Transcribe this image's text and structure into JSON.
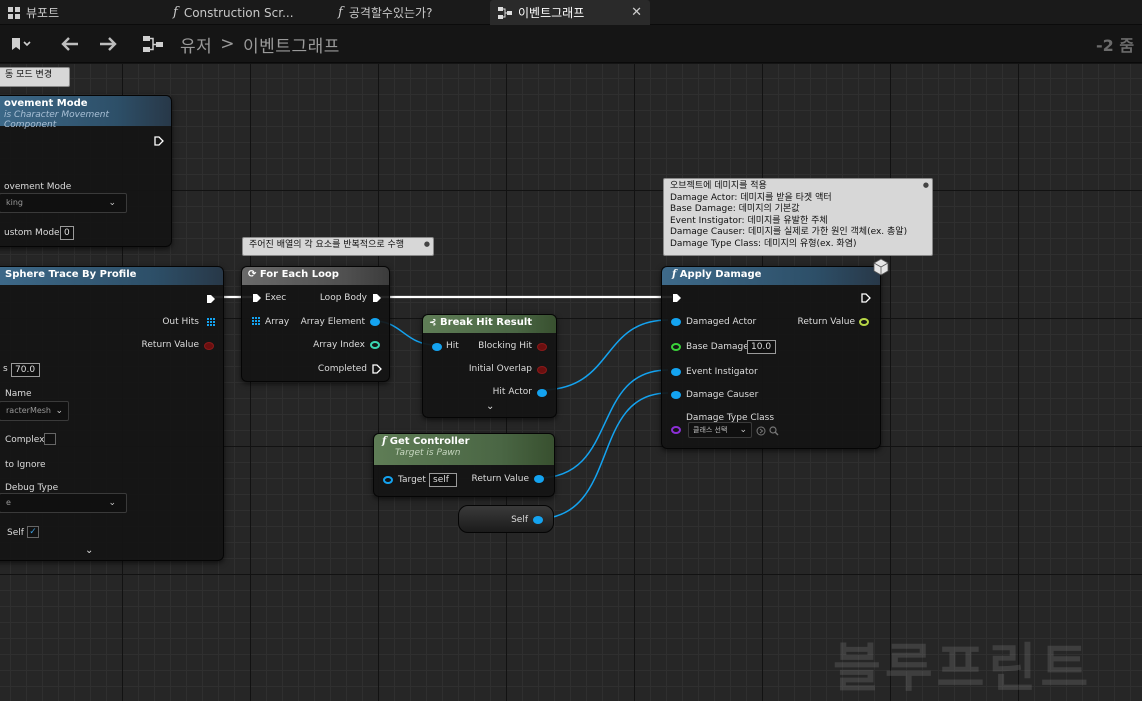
{
  "tabs": [
    {
      "label": "뷰포트",
      "icon": "grid-icon"
    },
    {
      "label": "Construction Scr...",
      "icon": "function-icon"
    },
    {
      "label": "공격할수있는가?",
      "icon": "function-icon"
    },
    {
      "label": "이벤트그래프",
      "icon": "graph-icon",
      "active": true
    }
  ],
  "toolbar": {
    "breadcrumb_root": "유저",
    "breadcrumb_sep": ">",
    "breadcrumb_current": "이벤트그래프",
    "zoom": "-2 줌"
  },
  "nodes": {
    "movement_comment": "동 모드 변경",
    "set_movement": {
      "title": "ovement Mode",
      "subtitle": "is Character Movement Component",
      "pin_mode": "ovement Mode",
      "mode_value": "king",
      "pin_custom": "ustom Mode",
      "custom_value": "0"
    },
    "sphere_trace": {
      "title": "Sphere Trace By Profile",
      "out_hits": "Out Hits",
      "return_value": "Return Value",
      "radius_suffix": "s",
      "radius_value": "70.0",
      "profile_name": "Name",
      "profile_value": "racterMesh",
      "trace_complex": "Complex",
      "actors_to_ignore": "to Ignore",
      "draw_debug": "Debug Type",
      "draw_debug_value": "e",
      "ignore_self": "Self"
    },
    "foreach_comment": "주어진 배열의 각 요소를 반복적으로 수행",
    "for_each": {
      "title": "For Each Loop",
      "exec": "Exec",
      "array": "Array",
      "loop_body": "Loop Body",
      "array_element": "Array Element",
      "array_index": "Array Index",
      "completed": "Completed"
    },
    "break_hit": {
      "title": "Break Hit Result",
      "hit": "Hit",
      "blocking_hit": "Blocking Hit",
      "initial_overlap": "Initial Overlap",
      "hit_actor": "Hit Actor"
    },
    "get_controller": {
      "title": "Get Controller",
      "subtitle": "Target is Pawn",
      "target": "Target",
      "target_value": "self",
      "return_value": "Return Value"
    },
    "self_node": {
      "label": "Self"
    },
    "damage_comment": [
      "오브젝트에 데미지를 적용",
      "Damage Actor: 데미지를 받을 타겟 액터",
      "Base Damage: 데미지의 기본값",
      "Event Instigator: 데미지를 유발한 주체",
      "Damage Causer: 데미지를 실제로 가한 원인 객체(ex. 총알)",
      "Damage Type Class: 데미지의 유형(ex. 화염)"
    ],
    "apply_damage": {
      "title": "Apply Damage",
      "damaged_actor": "Damaged Actor",
      "return_value": "Return Value",
      "base_damage": "Base Damage",
      "base_damage_value": "10.0",
      "event_instigator": "Event Instigator",
      "damage_causer": "Damage Causer",
      "damage_type_class": "Damage Type Class",
      "class_select": "클래스 선택"
    }
  },
  "watermark": "블루프린트",
  "colors": {
    "exec": "#ffffff",
    "object_pin": "#14a3f0",
    "bool_pin": "#8a1a1a",
    "float_pin": "#3ad13a"
  }
}
